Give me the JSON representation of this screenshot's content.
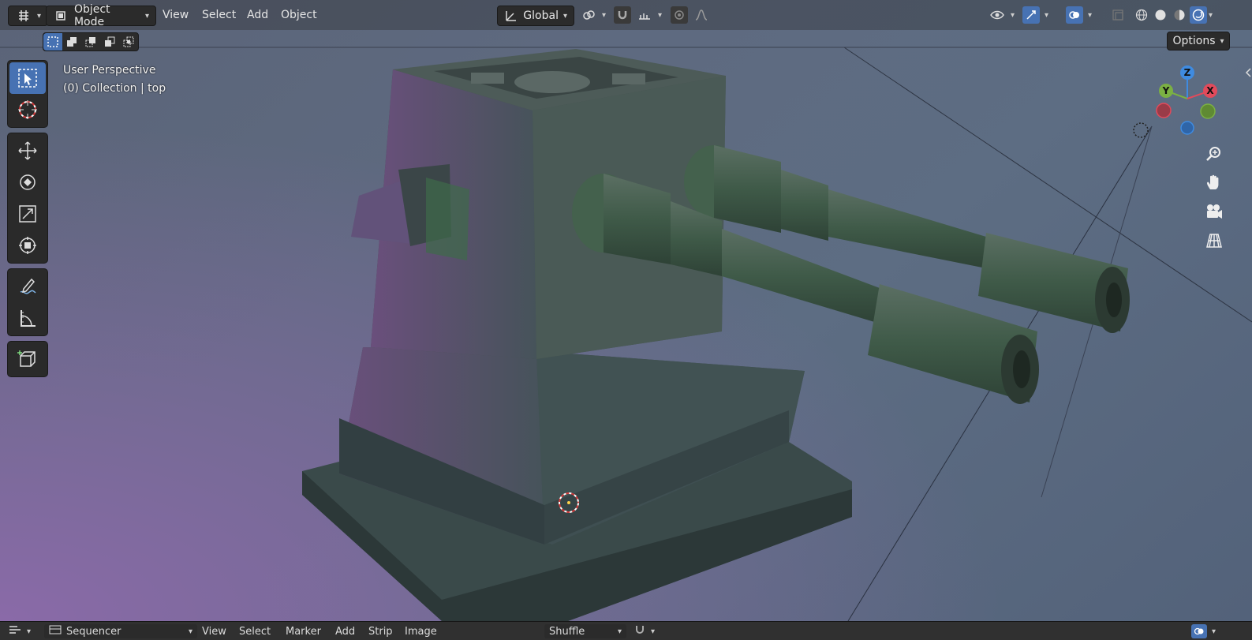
{
  "header": {
    "mode_label": "Object Mode",
    "menus": [
      "View",
      "Select",
      "Add",
      "Object"
    ],
    "transform_orientation": "Global",
    "options_label": "Options"
  },
  "overlay": {
    "view_name": "User Perspective",
    "collection_info": "(0) Collection | top"
  },
  "gizmo": {
    "z": "Z",
    "y": "Y",
    "x": "X",
    "colors": {
      "x": "#e24a5b",
      "y": "#7bb043",
      "z": "#3f8be0"
    }
  },
  "toolbar": {
    "tools": [
      "select-box",
      "cursor",
      "move",
      "rotate",
      "scale",
      "transform",
      "annotate",
      "measure",
      "add-cube"
    ]
  },
  "sequencer": {
    "editor_label": "Sequencer",
    "menus": [
      "View",
      "Select",
      "Marker",
      "Add",
      "Strip",
      "Image"
    ],
    "shuffle_label": "Shuffle"
  },
  "colors": {
    "accent": "#4772b3",
    "header_bg": "#2b2b2b"
  }
}
